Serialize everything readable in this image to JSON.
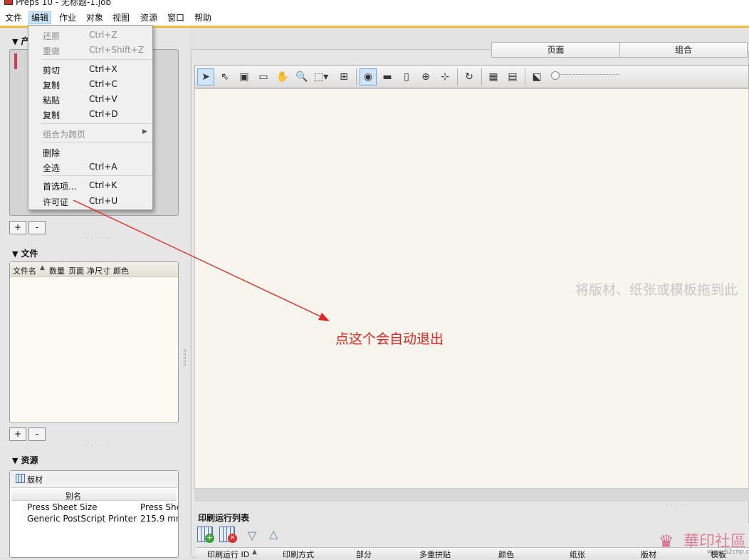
{
  "window": {
    "title": "Preps 10 - 无标题-1.job"
  },
  "menubar": {
    "items": [
      {
        "label": "文件"
      },
      {
        "label": "编辑"
      },
      {
        "label": "作业"
      },
      {
        "label": "对象"
      },
      {
        "label": "视图"
      },
      {
        "label": "资源"
      },
      {
        "label": "窗口"
      },
      {
        "label": "帮助"
      }
    ]
  },
  "edit_menu": {
    "undo": {
      "label": "还原",
      "shortcut": "Ctrl+Z"
    },
    "redo": {
      "label": "重做",
      "shortcut": "Ctrl+Shift+Z"
    },
    "cut": {
      "label": "剪切",
      "shortcut": "Ctrl+X"
    },
    "copy": {
      "label": "复制",
      "shortcut": "Ctrl+C"
    },
    "paste": {
      "label": "粘贴",
      "shortcut": "Ctrl+V"
    },
    "duplicate": {
      "label": "复制",
      "shortcut": "Ctrl+D"
    },
    "group_spread": {
      "label": "组合为跨页"
    },
    "delete": {
      "label": "删除"
    },
    "select_all": {
      "label": "全选",
      "shortcut": "Ctrl+A"
    },
    "preferences": {
      "label": "首选项...",
      "shortcut": "Ctrl+K"
    },
    "license": {
      "label": "许可证",
      "shortcut": "Ctrl+U"
    }
  },
  "left_panel": {
    "top_section_partial": "产",
    "add_label": "+",
    "remove_label": "-",
    "files": {
      "title": "文件",
      "columns": [
        "文件名",
        "数量",
        "页面",
        "净尺寸",
        "颜色"
      ]
    },
    "resources": {
      "title": "资源",
      "tab_label": "版材",
      "column": "别名",
      "rows": [
        {
          "name": "Press Sheet Size",
          "value": "Press She"
        },
        {
          "name": "Generic PostScript Printer",
          "value": "215.9 mr"
        }
      ]
    }
  },
  "tabs": {
    "pages": "页面",
    "signature": "组合"
  },
  "canvas": {
    "hint": "将版材、纸张或模板拖到此"
  },
  "print_run_list": {
    "title": "印刷运行列表",
    "columns": [
      "印刷运行 ID",
      "印刷方式",
      "部分",
      "多重拼贴",
      "颜色",
      "纸张",
      "版材",
      "模板"
    ]
  },
  "annotation": {
    "text": "点这个会自动退出",
    "color": "#e0261e"
  },
  "watermark": {
    "text": "華印社區",
    "sub": "www.52cnp.com"
  },
  "colors": {
    "menu_accent": "#f0bc3a",
    "selected_menu": "#cce4f7",
    "canvas_bg": "#f7f5ee"
  }
}
